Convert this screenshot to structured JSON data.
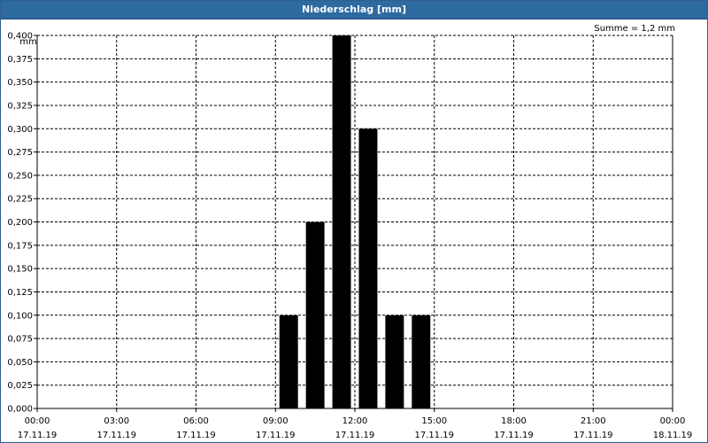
{
  "window": {
    "title": "Niederschlag [mm]"
  },
  "summary": {
    "text": "Summe = 1,2 mm"
  },
  "chart_data": {
    "type": "bar",
    "title": "Niederschlag [mm]",
    "ylabel": "mm",
    "ylim": [
      0,
      0.4
    ],
    "y_ticks": [
      "0,000",
      "0,025",
      "0,050",
      "0,075",
      "0,100",
      "0,125",
      "0,150",
      "0,175",
      "0,200",
      "0,225",
      "0,250",
      "0,275",
      "0,300",
      "0,325",
      "0,350",
      "0,375",
      "0,400"
    ],
    "x_ticks": [
      {
        "time": "00:00",
        "date": "17.11.19"
      },
      {
        "time": "03:00",
        "date": "17.11.19"
      },
      {
        "time": "06:00",
        "date": "17.11.19"
      },
      {
        "time": "09:00",
        "date": "17.11.19"
      },
      {
        "time": "12:00",
        "date": "17.11.19"
      },
      {
        "time": "15:00",
        "date": "17.11.19"
      },
      {
        "time": "18:00",
        "date": "17.11.19"
      },
      {
        "time": "21:00",
        "date": "17.11.19"
      },
      {
        "time": "00:00",
        "date": "18.11.19"
      }
    ],
    "x_range_hours": [
      0,
      24
    ],
    "bars": [
      {
        "start_hour": 9,
        "value": 0.1
      },
      {
        "start_hour": 10,
        "value": 0.2
      },
      {
        "start_hour": 11,
        "value": 0.4
      },
      {
        "start_hour": 12,
        "value": 0.3
      },
      {
        "start_hour": 13,
        "value": 0.1
      },
      {
        "start_hour": 14,
        "value": 0.1
      }
    ],
    "bar_color": "#000000",
    "grid": true,
    "grid_style": "dashed"
  }
}
